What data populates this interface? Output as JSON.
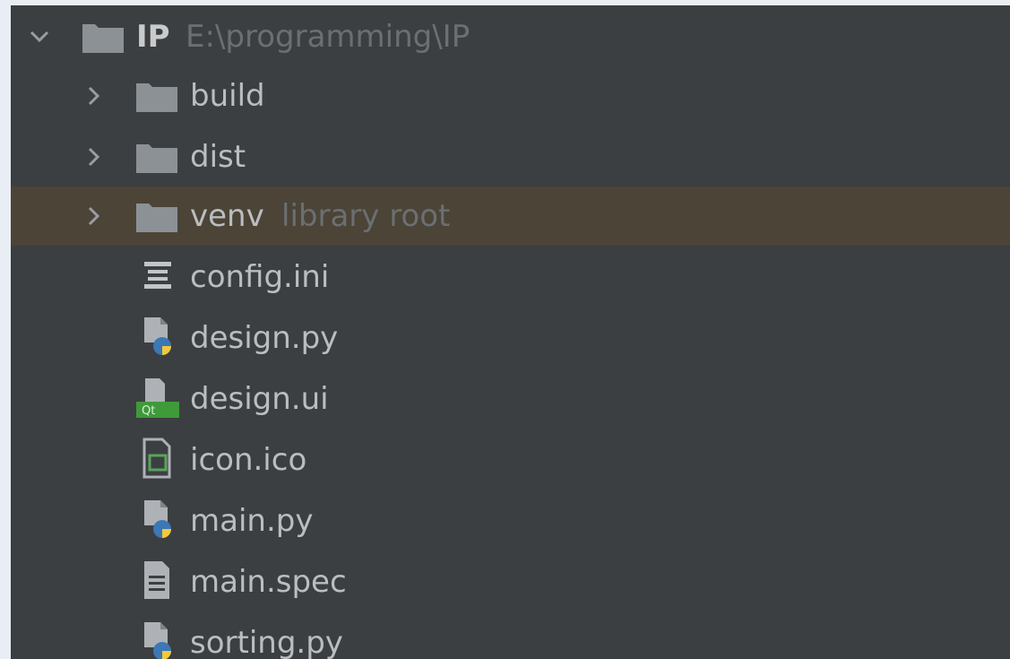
{
  "tree": {
    "root": {
      "name": "IP",
      "path": "E:\\programming\\IP",
      "expanded": true,
      "icon": "folder-icon"
    },
    "items": [
      {
        "name": "build",
        "type": "folder",
        "icon": "folder-icon",
        "collapsed": true
      },
      {
        "name": "dist",
        "type": "folder",
        "icon": "folder-icon",
        "collapsed": true
      },
      {
        "name": "venv",
        "hint": "library root",
        "type": "folder",
        "icon": "folder-icon",
        "collapsed": true,
        "selected": true
      },
      {
        "name": "config.ini",
        "type": "file",
        "icon": "ini-file-icon"
      },
      {
        "name": "design.py",
        "type": "file",
        "icon": "python-file-icon"
      },
      {
        "name": "design.ui",
        "type": "file",
        "icon": "qt-ui-file-icon"
      },
      {
        "name": "icon.ico",
        "type": "file",
        "icon": "image-file-icon"
      },
      {
        "name": "main.py",
        "type": "file",
        "icon": "python-file-icon"
      },
      {
        "name": "main.spec",
        "type": "file",
        "icon": "text-file-icon"
      },
      {
        "name": "sorting.py",
        "type": "file",
        "icon": "python-file-icon"
      }
    ]
  },
  "colors": {
    "panel_bg": "#3c3f41",
    "selection_bg": "#4b4437",
    "text": "#bbbdc0",
    "hint_text": "#6b6f72",
    "folder": "#8c9196"
  }
}
